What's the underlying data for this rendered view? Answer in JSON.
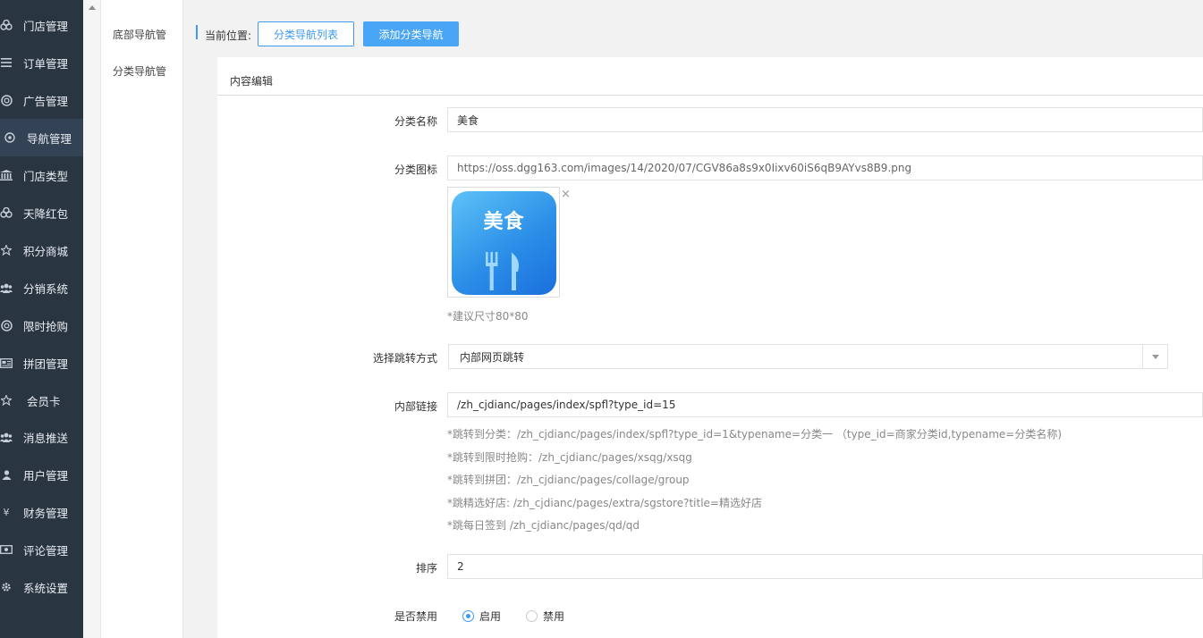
{
  "sidebar": {
    "items": [
      {
        "label": "门店管理",
        "icon": "cubes-icon"
      },
      {
        "label": "订单管理",
        "icon": "list-icon"
      },
      {
        "label": "广告管理",
        "icon": "lifebuoy-icon"
      },
      {
        "label": "导航管理",
        "icon": "compass-icon",
        "active": true
      },
      {
        "label": "门店类型",
        "icon": "bank-icon"
      },
      {
        "label": "天降红包",
        "icon": "cubes-icon"
      },
      {
        "label": "积分商城",
        "icon": "star-icon"
      },
      {
        "label": "分销系统",
        "icon": "users-icon"
      },
      {
        "label": "限时抢购",
        "icon": "lifebuoy-icon"
      },
      {
        "label": "拼团管理",
        "icon": "newspaper-icon"
      },
      {
        "label": "会员卡",
        "icon": "star-icon"
      },
      {
        "label": "消息推送",
        "icon": "users-icon"
      },
      {
        "label": "用户管理",
        "icon": "user-icon"
      },
      {
        "label": "财务管理",
        "icon": "yen-icon"
      },
      {
        "label": "评论管理",
        "icon": "money-icon"
      },
      {
        "label": "系统设置",
        "icon": "gear-icon"
      }
    ]
  },
  "subnav": {
    "items": [
      {
        "label": "底部导航管"
      },
      {
        "label": "分类导航管"
      }
    ]
  },
  "breadcrumb": {
    "label": "当前位置:",
    "list_button": "分类导航列表",
    "add_button": "添加分类导航"
  },
  "panel": {
    "title": "内容编辑"
  },
  "form": {
    "name_label": "分类名称",
    "name_value": "美食",
    "icon_label": "分类图标",
    "icon_value": "https://oss.dgg163.com/images/14/2020/07/CGV86a8s9x0Iixv60iS6qB9AYvs8B9.png",
    "icon_image_text": "美食",
    "icon_close": "×",
    "icon_hint": "*建议尺寸80*80",
    "jump_label": "选择跳转方式",
    "jump_value": "内部网页跳转",
    "link_label": "内部链接",
    "link_value": "/zh_cjdianc/pages/index/spfl?type_id=15",
    "link_hints": [
      "*跳转到分类：/zh_cjdianc/pages/index/spfl?type_id=1&typename=分类一 （type_id=商家分类id,typename=分类名称)",
      "*跳转到限时抢购：/zh_cjdianc/pages/xsqg/xsqg",
      "*跳转到拼团：/zh_cjdianc/pages/collage/group",
      "*跳精选好店: /zh_cjdianc/pages/extra/sgstore?title=精选好店",
      "*跳每日签到 /zh_cjdianc/pages/qd/qd"
    ],
    "sort_label": "排序",
    "sort_value": "2",
    "disable_label": "是否禁用",
    "enable_option": "启用",
    "disable_option": "禁用",
    "selected": "启用"
  },
  "colors": {
    "accent": "#3d9aef",
    "sidebar_bg": "#2a3542"
  }
}
